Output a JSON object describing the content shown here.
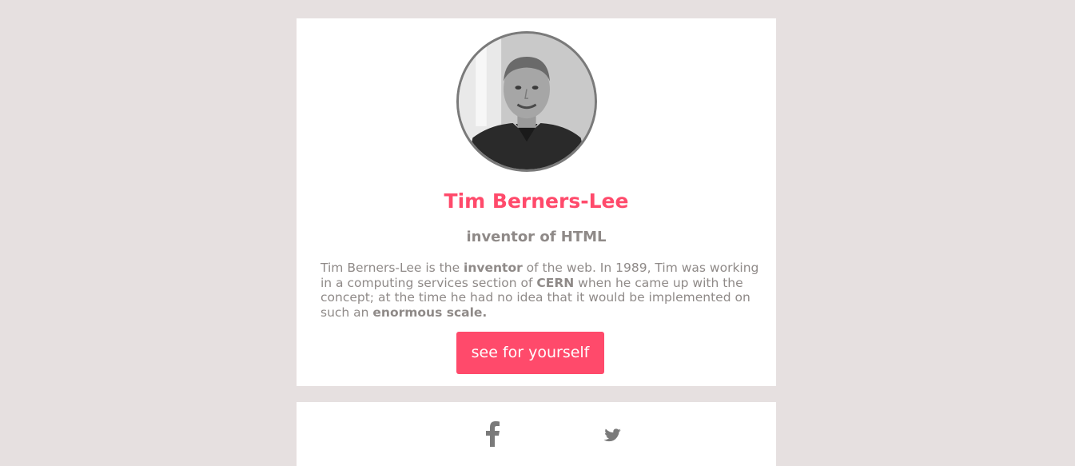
{
  "profile": {
    "avatar_alt": "Tim Berners-Lee",
    "name": "Tim Berners-Lee",
    "subtitle": "inventor of HTML",
    "bio": {
      "t1": "Tim Berners-Lee is the ",
      "b1": "inventor",
      "t2": " of the web. In 1989, Tim was working in a computing services section of ",
      "b2": "CERN",
      "t3": " when he came up with the concept; at the time he had no idea that it would be implemented on such an ",
      "b3": "enormous scale."
    },
    "cta_label": "see for yourself"
  },
  "social": {
    "icons": [
      "facebook-icon",
      "twitter-icon"
    ]
  },
  "colors": {
    "background": "#e6e0e0",
    "card": "#ffffff",
    "accent": "#ff4a6b",
    "muted_text": "#8f8a88",
    "icon": "#7a7a7a"
  }
}
